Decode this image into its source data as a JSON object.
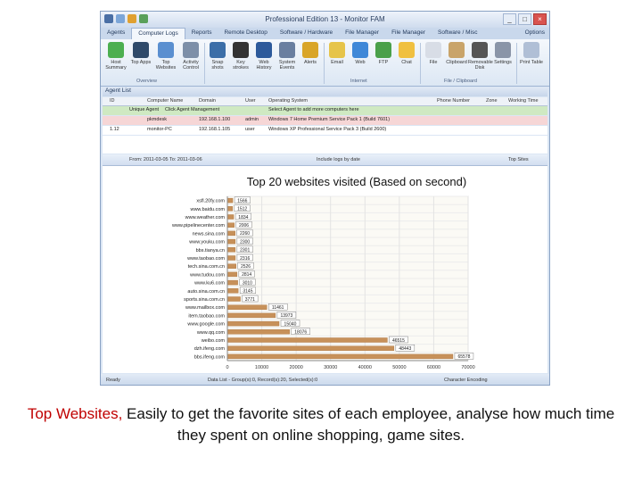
{
  "window": {
    "title": "Professional Edition 13 - Monitor FAM",
    "controls": [
      "_",
      "□",
      "×"
    ]
  },
  "tabs": [
    "Agents",
    "Computer Logs",
    "Reports",
    "Remote Desktop",
    "Software / Hardware",
    "File Manager",
    "File Manager",
    "Software / Misc"
  ],
  "active_tab": 1,
  "options_label": "Options",
  "ribbon": {
    "buttons": [
      "Host Summary",
      "Top Apps",
      "Top Websites",
      "Activity Control",
      "Snap shots",
      "Key strokes",
      "Web History",
      "System Events",
      "Alerts",
      "Email",
      "Web",
      "FTP",
      "Chat",
      "File",
      "Clipboard",
      "Removable Disk",
      "Settings",
      "Print Table"
    ],
    "groups": [
      "Overview",
      "Internet",
      "File / Clipboard"
    ]
  },
  "agent_list": {
    "title": "Agent List",
    "columns": [
      "ID",
      "Computer Name",
      "Domain",
      "User",
      "Operating System",
      "Phone Number",
      "Zone",
      "Working Time"
    ],
    "rows": [
      {
        "id": "",
        "name": "Unique Agent",
        "domain": "Click Agent Management",
        "user": "",
        "os": "Select Agent to add more computers here"
      },
      {
        "id": "",
        "name": "pkmdesk",
        "domain": "192.168.1.100",
        "user": "admin",
        "os": "Windows 7 Home Premium Service Pack 1 (Build 7601)"
      },
      {
        "id": "1.12",
        "name": "monitor-PC",
        "domain": "192.168.1.105",
        "user": "user",
        "os": "Windows XP Professional Service Pack 3 (Build 2600)"
      }
    ]
  },
  "chart_toolbar": {
    "range": "From: 2011-03-05  To: 2011-03-06",
    "checkbox": "Include logs by date",
    "button": "Top Sites"
  },
  "statusbar": {
    "status": "Ready",
    "data_list": "Data List - Group(s):0, Record(s):20, Selected(s):0",
    "encoding": "Character Encoding"
  },
  "caption": {
    "highlight": "Top Websites,",
    "rest": " Easily to get the favorite sites of each employee, analyse how much time they spent on online shopping, game sites."
  },
  "colors": {
    "bar": "#c7915a",
    "bar_dark": "#a96f3a",
    "highlight": "#c00000"
  },
  "chart_data": {
    "type": "bar",
    "orientation": "horizontal",
    "title": "Top 20 websites visited (Based on second)",
    "categories": [
      "xsfl.20fy.com",
      "www.baidu.com",
      "www.weather.com",
      "www.pipelinecenter.com",
      "news.sina.com",
      "www.youku.com",
      "bbs.tianya.cn",
      "www.taobao.com",
      "tech.sina.com.cn",
      "www.tudou.com",
      "www.ku6.com",
      "auto.sina.com.cn",
      "sports.sina.com.cn",
      "www.mailbox.com",
      "item.taobao.com",
      "www.google.com",
      "www.qq.com",
      "weibo.com",
      "dzh.ifeng.com",
      "bbs.ifeng.com"
    ],
    "values": [
      1566,
      1512,
      1834,
      2006,
      2260,
      2300,
      2301,
      2316,
      2526,
      2814,
      3010,
      3145,
      3771,
      11461,
      13973,
      15040,
      18076,
      46515,
      48443,
      65578
    ],
    "value_labels": [
      "1566",
      "1512",
      "1834",
      "2006",
      "2260",
      "2300",
      "2301",
      "2316",
      "2526",
      "2814",
      "3010",
      "3145",
      "3771",
      "11461",
      "13973",
      "15040",
      "18076",
      "46515",
      "48443",
      "65578"
    ],
    "xticks": [
      "0",
      "10000",
      "20000",
      "30000",
      "40000",
      "50000",
      "60000",
      "70000"
    ],
    "xlim": [
      0,
      70000
    ],
    "grid": true,
    "legend": "none"
  }
}
